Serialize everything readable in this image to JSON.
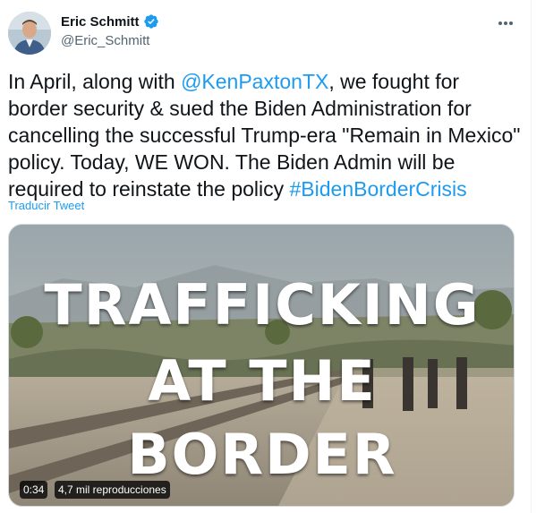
{
  "author": {
    "display_name": "Eric Schmitt",
    "handle": "@Eric_Schmitt",
    "verified": true
  },
  "tweet": {
    "text_parts": [
      {
        "text": "In April, along with ",
        "type": "text"
      },
      {
        "text": "@KenPaxtonTX",
        "type": "link"
      },
      {
        "text": ", we fought for border security & sued the Biden Administration for cancelling the successful Trump-era \"Remain in Mexico\" policy. Today, WE WON. The Biden Admin will be required to reinstate the policy ",
        "type": "text"
      },
      {
        "text": "#BidenBorderCrisis",
        "type": "link"
      }
    ],
    "translate_label": "Traducir Tweet"
  },
  "media": {
    "overlay_lines": [
      "TRAFFICKING",
      "AT THE",
      "BORDER"
    ],
    "duration": "0:34",
    "views": "4,7 mil reproducciones"
  },
  "colors": {
    "link": "#1d9bf0",
    "text": "#0f1419",
    "secondary": "#536471"
  }
}
